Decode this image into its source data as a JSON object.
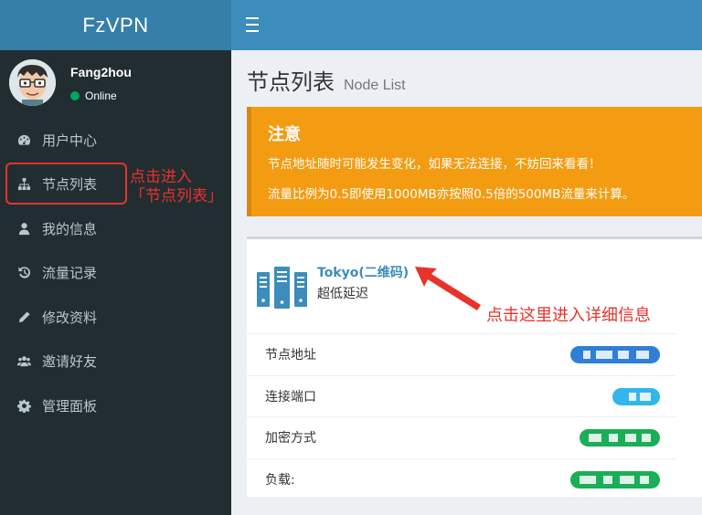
{
  "app": {
    "title": "FzVPN"
  },
  "user": {
    "name": "Fang2hou",
    "status": "Online"
  },
  "sidebar": {
    "items": [
      {
        "label": "用户中心",
        "icon": "dashboard-icon"
      },
      {
        "label": "节点列表",
        "icon": "sitemap-icon"
      },
      {
        "label": "我的信息",
        "icon": "user-icon"
      },
      {
        "label": "流量记录",
        "icon": "history-icon"
      },
      {
        "label": "修改资料",
        "icon": "pencil-icon"
      },
      {
        "label": "邀请好友",
        "icon": "users-icon"
      },
      {
        "label": "管理面板",
        "icon": "gear-icon"
      }
    ]
  },
  "annotations": {
    "sidebar_note": "点击进入\n「节点列表」",
    "node_note": "点击这里进入详细信息",
    "color": "#e8322a"
  },
  "page": {
    "title": "节点列表",
    "subtitle": "Node List"
  },
  "callout": {
    "title": "注意",
    "line1": "节点地址随时可能发生变化，如果无法连接，不妨回来看看！",
    "line2": "流量比例为0.5即使用1000MB亦按照0.5倍的500MB流量来计算。"
  },
  "node": {
    "name": "Tokyo(二维码)",
    "description": "超低延迟",
    "rows": [
      {
        "label": "节点地址"
      },
      {
        "label": "连接端口"
      },
      {
        "label": "加密方式"
      },
      {
        "label": "负载:"
      }
    ]
  },
  "colors": {
    "header": "#3c8dbc",
    "logo": "#367fa9",
    "sidebar": "#222d32",
    "callout": "#f39c12"
  }
}
